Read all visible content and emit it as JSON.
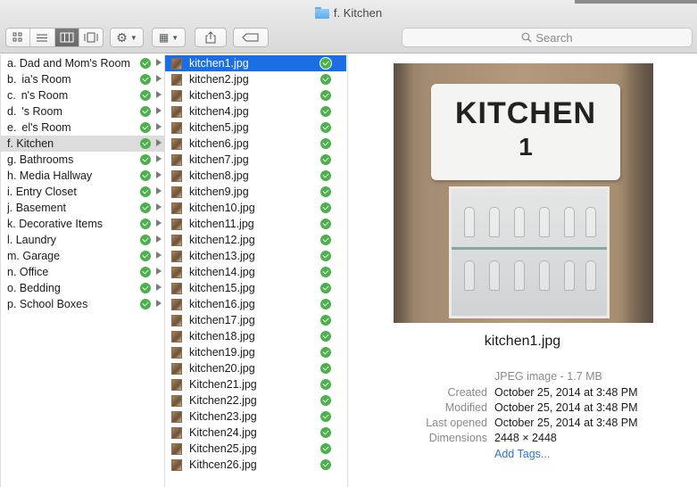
{
  "window": {
    "title": "f. Kitchen"
  },
  "toolbar": {
    "view_icons": [
      "icon-view-icon",
      "list-view-icon",
      "column-view-icon",
      "cover-flow-icon"
    ],
    "action_label": "⚙",
    "arrange_label": "▦",
    "share_icon": "share-icon",
    "tag_icon": "tag-icon",
    "search_placeholder": "Search"
  },
  "folders": [
    {
      "label": "a. Dad and Mom's Room",
      "selected": false
    },
    {
      "label": "b.  ia's Room",
      "selected": false
    },
    {
      "label": "c.  n's Room",
      "selected": false
    },
    {
      "label": "d.  's Room",
      "selected": false
    },
    {
      "label": "e.  el's Room",
      "selected": false
    },
    {
      "label": "f. Kitchen",
      "selected": true
    },
    {
      "label": "g. Bathrooms",
      "selected": false
    },
    {
      "label": "h. Media Hallway",
      "selected": false
    },
    {
      "label": "i. Entry Closet",
      "selected": false
    },
    {
      "label": "j. Basement",
      "selected": false
    },
    {
      "label": "k. Decorative Items",
      "selected": false
    },
    {
      "label": "l. Laundry",
      "selected": false
    },
    {
      "label": "m. Garage",
      "selected": false
    },
    {
      "label": "n. Office",
      "selected": false
    },
    {
      "label": "o. Bedding",
      "selected": false
    },
    {
      "label": "p. School Boxes",
      "selected": false
    }
  ],
  "files": [
    "kitchen1.jpg",
    "kitchen2.jpg",
    "kitchen3.jpg",
    "kitchen4.jpg",
    "kitchen5.jpg",
    "kitchen6.jpg",
    "kitchen7.jpg",
    "kitchen8.jpg",
    "kitchen9.jpg",
    "kitchen10.jpg",
    "kitchen11.jpg",
    "kitchen12.jpg",
    "kitchen13.jpg",
    "kitchen14.jpg",
    "kitchen15.jpg",
    "kitchen16.jpg",
    "kitchen17.jpg",
    "kitchen18.jpg",
    "kitchen19.jpg",
    "kitchen20.jpg",
    "Kitchen21.jpg",
    "Kitchen22.jpg",
    "Kitchen23.jpg",
    "Kitchen24.jpg",
    "Kitchen25.jpg",
    "Kithcen26.jpg"
  ],
  "selected_file_index": 0,
  "preview": {
    "label_text": "KITCHEN",
    "label_number": "1",
    "file_name": "kitchen1.jpg",
    "kind": "JPEG image - 1.7 MB",
    "info": [
      {
        "key": "Created",
        "value": "October 25, 2014 at 3:48 PM"
      },
      {
        "key": "Modified",
        "value": "October 25, 2014 at 3:48 PM"
      },
      {
        "key": "Last opened",
        "value": "October 25, 2014 at 3:48 PM"
      },
      {
        "key": "Dimensions",
        "value": "2448 × 2448"
      }
    ],
    "add_tags": "Add Tags..."
  },
  "colors": {
    "selection": "#1b6ee3",
    "status_green": "#49b24a",
    "link": "#2f73d6"
  }
}
